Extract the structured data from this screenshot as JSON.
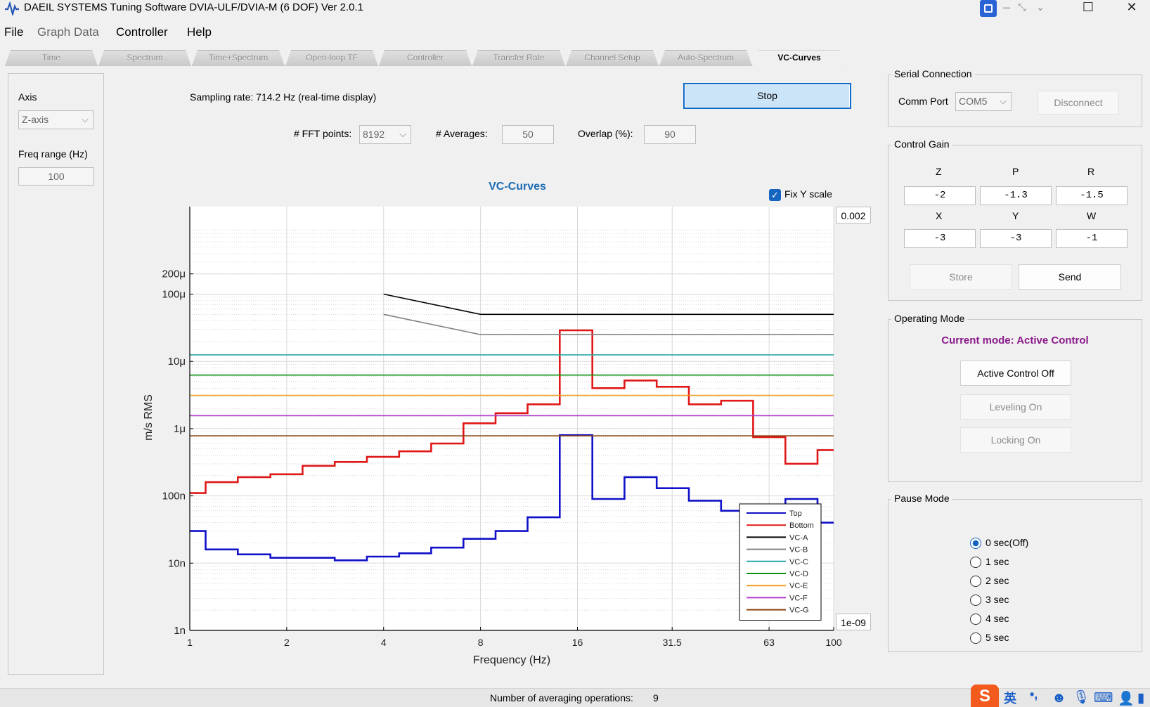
{
  "window": {
    "title": "DAEIL SYSTEMS Tuning Software DVIA-ULF/DVIA-M (6 DOF) Ver 2.0.1",
    "app_icon": "waveform-icon"
  },
  "menu": {
    "file": "File",
    "graph_data": "Graph Data",
    "controller": "Controller",
    "help": "Help"
  },
  "tabs": [
    {
      "label": "Time"
    },
    {
      "label": "Spectrum"
    },
    {
      "label": "Time+Spectrum"
    },
    {
      "label": "Open-loop TF"
    },
    {
      "label": "Controller"
    },
    {
      "label": "Transfer Rate"
    },
    {
      "label": "Channel Setup"
    },
    {
      "label": "Auto-Spectrum"
    },
    {
      "label": "VC-Curves"
    }
  ],
  "left_panel": {
    "axis_label": "Axis",
    "axis_value": "Z-axis",
    "freq_label": "Freq range (Hz)",
    "freq_value": "100"
  },
  "controls": {
    "sampling_rate": "Sampling rate: 714.2 Hz (real-time display)",
    "stop_label": "Stop",
    "fft_label": "# FFT points:",
    "fft_value": "8192",
    "averages_label": "# Averages:",
    "averages_value": "50",
    "overlap_label": "Overlap (%):",
    "overlap_value": "90",
    "fix_y_label": "Fix Y scale",
    "ymax_value": "0.002",
    "ymin_value": "1e-09"
  },
  "chart_data": {
    "type": "line",
    "title": "VC-Curves",
    "xlabel": "Frequency (Hz)",
    "ylabel": "m/s RMS",
    "x_scale": "log",
    "y_scale": "log",
    "xlim": [
      1,
      100
    ],
    "ylim": [
      1e-09,
      0.002
    ],
    "x_ticks": [
      {
        "value": 1,
        "label": "1"
      },
      {
        "value": 2,
        "label": "2"
      },
      {
        "value": 4,
        "label": "4"
      },
      {
        "value": 8,
        "label": "8"
      },
      {
        "value": 16,
        "label": "16"
      },
      {
        "value": 31.5,
        "label": "31.5"
      },
      {
        "value": 63,
        "label": "63"
      },
      {
        "value": 100,
        "label": "100"
      }
    ],
    "y_ticks": [
      {
        "value": 1e-09,
        "label": "1n"
      },
      {
        "value": 1e-08,
        "label": "10n"
      },
      {
        "value": 1e-07,
        "label": "100n"
      },
      {
        "value": 1e-06,
        "label": "1μ"
      },
      {
        "value": 1e-05,
        "label": "10μ"
      },
      {
        "value": 0.0001,
        "label": "100μ"
      },
      {
        "value": 0.0002,
        "label": "200μ"
      }
    ],
    "grid": true,
    "legend_position": "bottom-right",
    "series": [
      {
        "name": "Top",
        "color": "#1010c8",
        "style": "step",
        "x": [
          1,
          1.12,
          1.41,
          1.78,
          2.24,
          2.82,
          3.55,
          4.47,
          5.62,
          7.08,
          8.91,
          11.2,
          14.1,
          17.8,
          22.4,
          28.2,
          35.5,
          44.7,
          56.2,
          70.8,
          89.1,
          100
        ],
        "y": [
          3e-08,
          1.6e-08,
          1.35e-08,
          1.2e-08,
          1.2e-08,
          1.1e-08,
          1.25e-08,
          1.4e-08,
          1.7e-08,
          2.3e-08,
          3e-08,
          4.8e-08,
          8e-07,
          9e-08,
          1.9e-07,
          1.3e-07,
          8.5e-08,
          6e-08,
          6.5e-08,
          9e-08,
          4e-08,
          4e-08
        ]
      },
      {
        "name": "Bottom",
        "color": "#e01818",
        "style": "step",
        "x": [
          1,
          1.12,
          1.41,
          1.78,
          2.24,
          2.82,
          3.55,
          4.47,
          5.62,
          7.08,
          8.91,
          11.2,
          14.1,
          17.8,
          22.4,
          28.2,
          35.5,
          44.7,
          56.2,
          70.8,
          89.1,
          100
        ],
        "y": [
          1.1e-07,
          1.6e-07,
          1.9e-07,
          2.1e-07,
          2.8e-07,
          3.2e-07,
          3.8e-07,
          4.6e-07,
          6e-07,
          1.2e-06,
          1.7e-06,
          2.3e-06,
          2.9e-05,
          4e-06,
          5.2e-06,
          4.2e-06,
          2.3e-06,
          2.6e-06,
          7.5e-07,
          3e-07,
          4.8e-07,
          4.8e-07
        ]
      },
      {
        "name": "VC-A",
        "color": "#000000",
        "style": "line",
        "x": [
          4,
          8,
          100
        ],
        "y": [
          0.0001,
          5e-05,
          5e-05
        ]
      },
      {
        "name": "VC-B",
        "color": "#808080",
        "style": "line",
        "x": [
          4,
          8,
          100
        ],
        "y": [
          5e-05,
          2.5e-05,
          2.5e-05
        ]
      },
      {
        "name": "VC-C",
        "color": "#2aa8a8",
        "style": "line",
        "x": [
          1,
          100
        ],
        "y": [
          1.25e-05,
          1.25e-05
        ]
      },
      {
        "name": "VC-D",
        "color": "#129012",
        "style": "line",
        "x": [
          1,
          100
        ],
        "y": [
          6.25e-06,
          6.25e-06
        ]
      },
      {
        "name": "VC-E",
        "color": "#f0a020",
        "style": "line",
        "x": [
          1,
          100
        ],
        "y": [
          3.12e-06,
          3.12e-06
        ]
      },
      {
        "name": "VC-F",
        "color": "#b040c8",
        "style": "line",
        "x": [
          1,
          100
        ],
        "y": [
          1.56e-06,
          1.56e-06
        ]
      },
      {
        "name": "VC-G",
        "color": "#8b4513",
        "style": "line",
        "x": [
          1,
          100
        ],
        "y": [
          7.8e-07,
          7.8e-07
        ]
      }
    ]
  },
  "serial": {
    "title": "Serial Connection",
    "port_label": "Comm Port",
    "port_value": "COM5",
    "disconnect_label": "Disconnect"
  },
  "gain": {
    "title": "Control Gain",
    "headers1": [
      "Z",
      "P",
      "R"
    ],
    "values1": [
      "-2",
      "-1.3",
      "-1.5"
    ],
    "headers2": [
      "X",
      "Y",
      "W"
    ],
    "values2": [
      "-3",
      "-3",
      "-1"
    ],
    "store_label": "Store",
    "send_label": "Send"
  },
  "mode": {
    "title": "Operating Mode",
    "current": "Current mode: Active Control",
    "current_color": "#8b1a8b",
    "active_off": "Active Control Off",
    "leveling_on": "Leveling On",
    "locking_on": "Locking On"
  },
  "pause": {
    "title": "Pause Mode",
    "options": [
      "0 sec(Off)",
      "1 sec",
      "2 sec",
      "3 sec",
      "4 sec",
      "5 sec"
    ],
    "selected_index": 0
  },
  "status": {
    "label": "Number of averaging operations:",
    "value": "9"
  },
  "taskbar": {
    "ime_lang": "英",
    "ime_punct": "•,"
  }
}
